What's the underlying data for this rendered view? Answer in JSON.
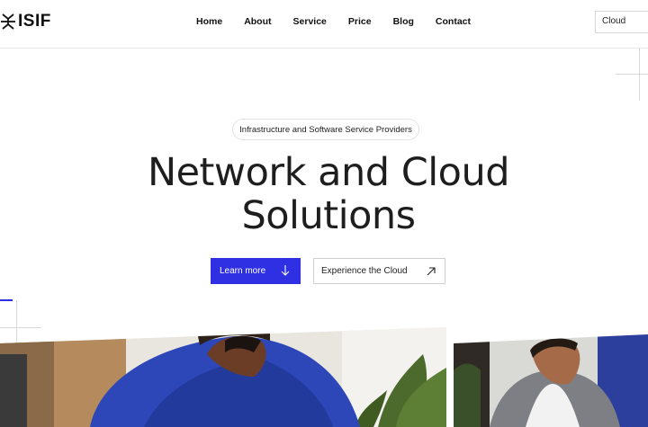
{
  "header": {
    "logo_text": "ISIF",
    "nav": [
      "Home",
      "About",
      "Service",
      "Price",
      "Blog",
      "Contact"
    ],
    "search_value": "Cloud"
  },
  "hero": {
    "badge": "Infrastructure and Software Service Providers",
    "title_line1": "Network and Cloud",
    "title_line2": "Solutions",
    "primary_button": "Learn more",
    "secondary_button": "Experience the Cloud"
  },
  "colors": {
    "accent": "#2f2fe4",
    "text": "#1e1e1e",
    "border": "#d6d6d6"
  },
  "icons": [
    "logo-icon",
    "arrow-down-icon",
    "arrow-up-right-icon"
  ]
}
